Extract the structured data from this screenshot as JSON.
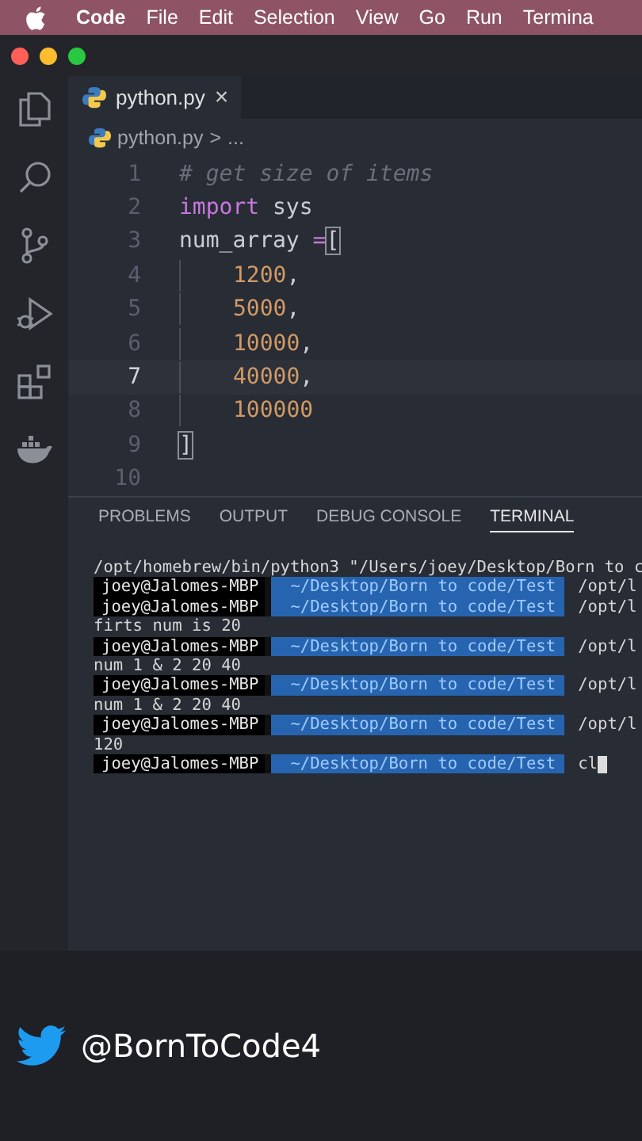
{
  "menu_bar": {
    "items": [
      {
        "label": "Code",
        "bold": true
      },
      {
        "label": "File",
        "bold": false
      },
      {
        "label": "Edit",
        "bold": false
      },
      {
        "label": "Selection",
        "bold": false
      },
      {
        "label": "View",
        "bold": false
      },
      {
        "label": "Go",
        "bold": false
      },
      {
        "label": "Run",
        "bold": false
      },
      {
        "label": "Termina",
        "bold": false
      }
    ]
  },
  "activity_bar": [
    {
      "kind": "files",
      "selected": false
    },
    {
      "kind": "search",
      "selected": false
    },
    {
      "kind": "git",
      "selected": false
    },
    {
      "kind": "debug",
      "selected": false
    },
    {
      "kind": "extensions",
      "selected": false
    },
    {
      "kind": "docker",
      "selected": false
    }
  ],
  "tab": {
    "label": "python.py",
    "close": "×"
  },
  "breadcrumb": {
    "file": "python.py",
    "separator": ">",
    "rest": "..."
  },
  "editor": {
    "lines": [
      {
        "number": "1",
        "current": false,
        "tokens": [
          {
            "kind": "comment",
            "text": "# get size of items"
          }
        ]
      },
      {
        "number": "2",
        "current": false,
        "tokens": [
          {
            "kind": "keyword",
            "text": "import"
          },
          {
            "kind": "plain",
            "text": " sys"
          }
        ]
      },
      {
        "number": "3",
        "current": false,
        "tokens": [
          {
            "kind": "plain",
            "text": "num_array "
          },
          {
            "kind": "operator",
            "text": "="
          },
          {
            "kind": "bracket",
            "text": "["
          }
        ]
      },
      {
        "number": "4",
        "current": false,
        "indented": true,
        "tokens": [
          {
            "kind": "number",
            "text": "1200"
          },
          {
            "kind": "plain",
            "text": ","
          }
        ]
      },
      {
        "number": "5",
        "current": false,
        "indented": true,
        "tokens": [
          {
            "kind": "number",
            "text": "5000"
          },
          {
            "kind": "plain",
            "text": ","
          }
        ]
      },
      {
        "number": "6",
        "current": false,
        "indented": true,
        "tokens": [
          {
            "kind": "number",
            "text": "10000"
          },
          {
            "kind": "plain",
            "text": ","
          }
        ]
      },
      {
        "number": "7",
        "current": true,
        "indented": true,
        "tokens": [
          {
            "kind": "number",
            "text": "40000"
          },
          {
            "kind": "plain",
            "text": ","
          }
        ]
      },
      {
        "number": "8",
        "current": false,
        "indented": true,
        "tokens": [
          {
            "kind": "number",
            "text": "100000"
          }
        ]
      },
      {
        "number": "9",
        "current": false,
        "tokens": [
          {
            "kind": "bracket",
            "text": "]"
          }
        ]
      },
      {
        "number": "10",
        "current": false
      }
    ]
  },
  "panel_tabs": [
    {
      "label": "PROBLEMS",
      "selected": false
    },
    {
      "label": "OUTPUT",
      "selected": false
    },
    {
      "label": "DEBUG CONSOLE",
      "selected": false
    },
    {
      "label": "TERMINAL",
      "selected": true
    }
  ],
  "terminal": {
    "lines": [
      {
        "kind": "output",
        "text": "/opt/homebrew/bin/python3 \"/Users/joey/Desktop/Born to c"
      },
      {
        "kind": "prompt",
        "user": "joey@Jalomes-MBP",
        "path": "~/Desktop/Born to code/Test",
        "command": "/opt/l"
      },
      {
        "kind": "prompt",
        "user": "joey@Jalomes-MBP",
        "path": "~/Desktop/Born to code/Test",
        "command": "/opt/l"
      },
      {
        "kind": "output",
        "text": "firts num is 20"
      },
      {
        "kind": "prompt",
        "user": "joey@Jalomes-MBP",
        "path": "~/Desktop/Born to code/Test",
        "command": "/opt/l"
      },
      {
        "kind": "output",
        "text": "num 1 & 2 20 40"
      },
      {
        "kind": "prompt",
        "user": "joey@Jalomes-MBP",
        "path": "~/Desktop/Born to code/Test",
        "command": "/opt/l"
      },
      {
        "kind": "output",
        "text": "num 1 & 2 20 40"
      },
      {
        "kind": "prompt",
        "user": "joey@Jalomes-MBP",
        "path": "~/Desktop/Born to code/Test",
        "command": "/opt/l"
      },
      {
        "kind": "output",
        "text": "120"
      },
      {
        "kind": "prompt",
        "user": "joey@Jalomes-MBP",
        "path": "~/Desktop/Born to code/Test",
        "command": "cl",
        "cursor": true
      }
    ]
  },
  "social": {
    "handle": "@BornToCode4"
  }
}
